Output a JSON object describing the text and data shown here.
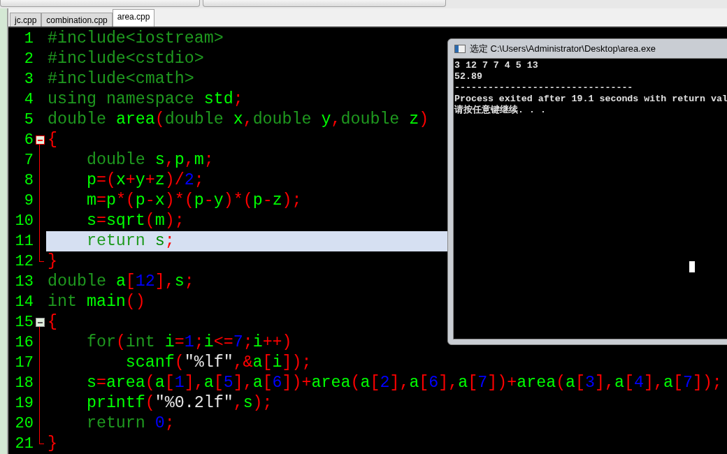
{
  "tabs": [
    {
      "label": "jc.cpp",
      "selected": false
    },
    {
      "label": "combination.cpp",
      "selected": false
    },
    {
      "label": "area.cpp",
      "selected": true
    }
  ],
  "editor": {
    "lines": [
      {
        "number": "1",
        "tokens": [
          {
            "kind": "kw",
            "text": "#include<iostream>"
          }
        ]
      },
      {
        "number": "2",
        "tokens": [
          {
            "kind": "kw",
            "text": "#include<cstdio>"
          }
        ]
      },
      {
        "number": "3",
        "tokens": [
          {
            "kind": "kw",
            "text": "#include<cmath>"
          }
        ]
      },
      {
        "number": "4",
        "tokens": [
          {
            "kind": "kw",
            "text": "using namespace "
          },
          {
            "kind": "id",
            "text": "std"
          },
          {
            "kind": "sym",
            "text": ";"
          }
        ]
      },
      {
        "number": "5",
        "tokens": [
          {
            "kind": "kw",
            "text": "double "
          },
          {
            "kind": "id",
            "text": "area"
          },
          {
            "kind": "sym",
            "text": "("
          },
          {
            "kind": "kw",
            "text": "double "
          },
          {
            "kind": "id",
            "text": "x"
          },
          {
            "kind": "sym",
            "text": ","
          },
          {
            "kind": "kw",
            "text": "double "
          },
          {
            "kind": "id",
            "text": "y"
          },
          {
            "kind": "sym",
            "text": ","
          },
          {
            "kind": "kw",
            "text": "double "
          },
          {
            "kind": "id",
            "text": "z"
          },
          {
            "kind": "sym",
            "text": ")"
          }
        ]
      },
      {
        "number": "6",
        "fold": {
          "kind": "start",
          "active": true
        },
        "tokens": [
          {
            "kind": "sym",
            "text": "{"
          }
        ]
      },
      {
        "number": "7",
        "fold": {
          "kind": "mid"
        },
        "tokens": [
          {
            "kind": "kw",
            "text": "    double "
          },
          {
            "kind": "id",
            "text": "s"
          },
          {
            "kind": "sym",
            "text": ","
          },
          {
            "kind": "id",
            "text": "p"
          },
          {
            "kind": "sym",
            "text": ","
          },
          {
            "kind": "id",
            "text": "m"
          },
          {
            "kind": "sym",
            "text": ";"
          }
        ]
      },
      {
        "number": "8",
        "fold": {
          "kind": "mid"
        },
        "tokens": [
          {
            "kind": "id",
            "text": "    p"
          },
          {
            "kind": "sym",
            "text": "=("
          },
          {
            "kind": "id",
            "text": "x"
          },
          {
            "kind": "sym",
            "text": "+"
          },
          {
            "kind": "id",
            "text": "y"
          },
          {
            "kind": "sym",
            "text": "+"
          },
          {
            "kind": "id",
            "text": "z"
          },
          {
            "kind": "sym",
            "text": ")/"
          },
          {
            "kind": "num",
            "text": "2"
          },
          {
            "kind": "sym",
            "text": ";"
          }
        ]
      },
      {
        "number": "9",
        "fold": {
          "kind": "mid"
        },
        "tokens": [
          {
            "kind": "id",
            "text": "    m"
          },
          {
            "kind": "sym",
            "text": "="
          },
          {
            "kind": "id",
            "text": "p"
          },
          {
            "kind": "sym",
            "text": "*("
          },
          {
            "kind": "id",
            "text": "p"
          },
          {
            "kind": "sym",
            "text": "-"
          },
          {
            "kind": "id",
            "text": "x"
          },
          {
            "kind": "sym",
            "text": ")*("
          },
          {
            "kind": "id",
            "text": "p"
          },
          {
            "kind": "sym",
            "text": "-"
          },
          {
            "kind": "id",
            "text": "y"
          },
          {
            "kind": "sym",
            "text": ")*("
          },
          {
            "kind": "id",
            "text": "p"
          },
          {
            "kind": "sym",
            "text": "-"
          },
          {
            "kind": "id",
            "text": "z"
          },
          {
            "kind": "sym",
            "text": ");"
          }
        ]
      },
      {
        "number": "10",
        "fold": {
          "kind": "mid"
        },
        "tokens": [
          {
            "kind": "id",
            "text": "    s"
          },
          {
            "kind": "sym",
            "text": "="
          },
          {
            "kind": "id",
            "text": "sqrt"
          },
          {
            "kind": "sym",
            "text": "("
          },
          {
            "kind": "id",
            "text": "m"
          },
          {
            "kind": "sym",
            "text": ");"
          }
        ]
      },
      {
        "number": "11",
        "fold": {
          "kind": "mid"
        },
        "current": true,
        "tokens": [
          {
            "kind": "kw",
            "text": "    return "
          },
          {
            "kind": "id",
            "text": "s"
          },
          {
            "kind": "sym",
            "text": ";"
          }
        ]
      },
      {
        "number": "12",
        "fold": {
          "kind": "end"
        },
        "tokens": [
          {
            "kind": "sym",
            "text": "}"
          }
        ]
      },
      {
        "number": "13",
        "tokens": [
          {
            "kind": "kw",
            "text": "double "
          },
          {
            "kind": "id",
            "text": "a"
          },
          {
            "kind": "sym",
            "text": "["
          },
          {
            "kind": "num",
            "text": "12"
          },
          {
            "kind": "sym",
            "text": "],"
          },
          {
            "kind": "id",
            "text": "s"
          },
          {
            "kind": "sym",
            "text": ";"
          }
        ]
      },
      {
        "number": "14",
        "tokens": [
          {
            "kind": "kw",
            "text": "int "
          },
          {
            "kind": "id",
            "text": "main"
          },
          {
            "kind": "sym",
            "text": "()"
          }
        ]
      },
      {
        "number": "15",
        "fold": {
          "kind": "start",
          "active": false
        },
        "tokens": [
          {
            "kind": "sym",
            "text": "{"
          }
        ]
      },
      {
        "number": "16",
        "fold": {
          "kind": "mid"
        },
        "tokens": [
          {
            "kind": "kw",
            "text": "    for"
          },
          {
            "kind": "sym",
            "text": "("
          },
          {
            "kind": "kw",
            "text": "int "
          },
          {
            "kind": "id",
            "text": "i"
          },
          {
            "kind": "sym",
            "text": "="
          },
          {
            "kind": "num",
            "text": "1"
          },
          {
            "kind": "sym",
            "text": ";"
          },
          {
            "kind": "id",
            "text": "i"
          },
          {
            "kind": "sym",
            "text": "<="
          },
          {
            "kind": "num",
            "text": "7"
          },
          {
            "kind": "sym",
            "text": ";"
          },
          {
            "kind": "id",
            "text": "i"
          },
          {
            "kind": "sym",
            "text": "++)"
          }
        ]
      },
      {
        "number": "17",
        "fold": {
          "kind": "mid"
        },
        "tokens": [
          {
            "kind": "id",
            "text": "        scanf"
          },
          {
            "kind": "sym",
            "text": "("
          },
          {
            "kind": "str",
            "text": "\"%lf\""
          },
          {
            "kind": "sym",
            "text": ",&"
          },
          {
            "kind": "id",
            "text": "a"
          },
          {
            "kind": "sym",
            "text": "["
          },
          {
            "kind": "id",
            "text": "i"
          },
          {
            "kind": "sym",
            "text": "]);"
          }
        ]
      },
      {
        "number": "18",
        "fold": {
          "kind": "mid"
        },
        "tokens": [
          {
            "kind": "id",
            "text": "    s"
          },
          {
            "kind": "sym",
            "text": "="
          },
          {
            "kind": "id",
            "text": "area"
          },
          {
            "kind": "sym",
            "text": "("
          },
          {
            "kind": "id",
            "text": "a"
          },
          {
            "kind": "sym",
            "text": "["
          },
          {
            "kind": "num",
            "text": "1"
          },
          {
            "kind": "sym",
            "text": "],"
          },
          {
            "kind": "id",
            "text": "a"
          },
          {
            "kind": "sym",
            "text": "["
          },
          {
            "kind": "num",
            "text": "5"
          },
          {
            "kind": "sym",
            "text": "],"
          },
          {
            "kind": "id",
            "text": "a"
          },
          {
            "kind": "sym",
            "text": "["
          },
          {
            "kind": "num",
            "text": "6"
          },
          {
            "kind": "sym",
            "text": "])+"
          },
          {
            "kind": "id",
            "text": "area"
          },
          {
            "kind": "sym",
            "text": "("
          },
          {
            "kind": "id",
            "text": "a"
          },
          {
            "kind": "sym",
            "text": "["
          },
          {
            "kind": "num",
            "text": "2"
          },
          {
            "kind": "sym",
            "text": "],"
          },
          {
            "kind": "id",
            "text": "a"
          },
          {
            "kind": "sym",
            "text": "["
          },
          {
            "kind": "num",
            "text": "6"
          },
          {
            "kind": "sym",
            "text": "],"
          },
          {
            "kind": "id",
            "text": "a"
          },
          {
            "kind": "sym",
            "text": "["
          },
          {
            "kind": "num",
            "text": "7"
          },
          {
            "kind": "sym",
            "text": "])+"
          },
          {
            "kind": "id",
            "text": "area"
          },
          {
            "kind": "sym",
            "text": "("
          },
          {
            "kind": "id",
            "text": "a"
          },
          {
            "kind": "sym",
            "text": "["
          },
          {
            "kind": "num",
            "text": "3"
          },
          {
            "kind": "sym",
            "text": "],"
          },
          {
            "kind": "id",
            "text": "a"
          },
          {
            "kind": "sym",
            "text": "["
          },
          {
            "kind": "num",
            "text": "4"
          },
          {
            "kind": "sym",
            "text": "],"
          },
          {
            "kind": "id",
            "text": "a"
          },
          {
            "kind": "sym",
            "text": "["
          },
          {
            "kind": "num",
            "text": "7"
          },
          {
            "kind": "sym",
            "text": "]);"
          }
        ]
      },
      {
        "number": "19",
        "fold": {
          "kind": "mid"
        },
        "tokens": [
          {
            "kind": "id",
            "text": "    printf"
          },
          {
            "kind": "sym",
            "text": "("
          },
          {
            "kind": "str",
            "text": "\"%0.2lf\""
          },
          {
            "kind": "sym",
            "text": ","
          },
          {
            "kind": "id",
            "text": "s"
          },
          {
            "kind": "sym",
            "text": ");"
          }
        ]
      },
      {
        "number": "20",
        "fold": {
          "kind": "mid"
        },
        "tokens": [
          {
            "kind": "kw",
            "text": "    return "
          },
          {
            "kind": "num",
            "text": "0"
          },
          {
            "kind": "sym",
            "text": ";"
          }
        ]
      },
      {
        "number": "21",
        "fold": {
          "kind": "end"
        },
        "tokens": [
          {
            "kind": "sym",
            "text": "}"
          }
        ]
      }
    ]
  },
  "console": {
    "title": "选定 C:\\Users\\Administrator\\Desktop\\area.exe",
    "lines": [
      "3 12 7 7 4 5 13",
      "52.89",
      "--------------------------------",
      "Process exited after 19.1 seconds with return val",
      "请按任意键继续. . ."
    ]
  }
}
